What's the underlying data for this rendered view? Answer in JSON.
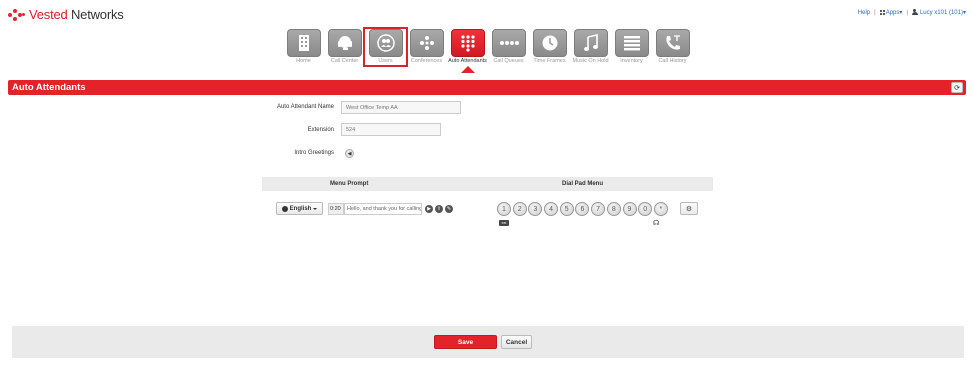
{
  "brand": {
    "logo_part1": "Vested",
    "logo_part2": " Networks",
    "accent": "#e3222a"
  },
  "topbar": {
    "help": "Help",
    "apps": "Apps",
    "user": "Lucy x101 (101)"
  },
  "nav": [
    {
      "label": "Home",
      "icon": "building-icon"
    },
    {
      "label": "Call Center",
      "icon": "headset-icon"
    },
    {
      "label": "Users",
      "icon": "users-icon"
    },
    {
      "label": "Conferences",
      "icon": "conference-icon"
    },
    {
      "label": "Auto Attendants",
      "icon": "dialpad-icon"
    },
    {
      "label": "Call Queues",
      "icon": "queue-icon"
    },
    {
      "label": "Time Frames",
      "icon": "clock-icon"
    },
    {
      "label": "Music On Hold",
      "icon": "music-icon"
    },
    {
      "label": "Inventory",
      "icon": "list-icon"
    },
    {
      "label": "Call History",
      "icon": "phone-history-icon"
    }
  ],
  "section": {
    "title": "Auto Attendants"
  },
  "form": {
    "name_label": "Auto Attendant Name",
    "name_placeholder": "West Office Temp AA",
    "extension_label": "Extension",
    "extension_placeholder": "524",
    "greetings_label": "Intro Greetings"
  },
  "table": {
    "menu_prompt_header": "Menu Prompt",
    "dial_pad_header": "Dial Pad Menu"
  },
  "row": {
    "language": "English",
    "duration": "0:20",
    "prompt_text": "Hello, and thank you for calling"
  },
  "dialpad": [
    "1",
    "2",
    "3",
    "4",
    "5",
    "6",
    "7",
    "8",
    "9",
    "0",
    "*"
  ],
  "footer": {
    "save": "Save",
    "cancel": "Cancel"
  }
}
